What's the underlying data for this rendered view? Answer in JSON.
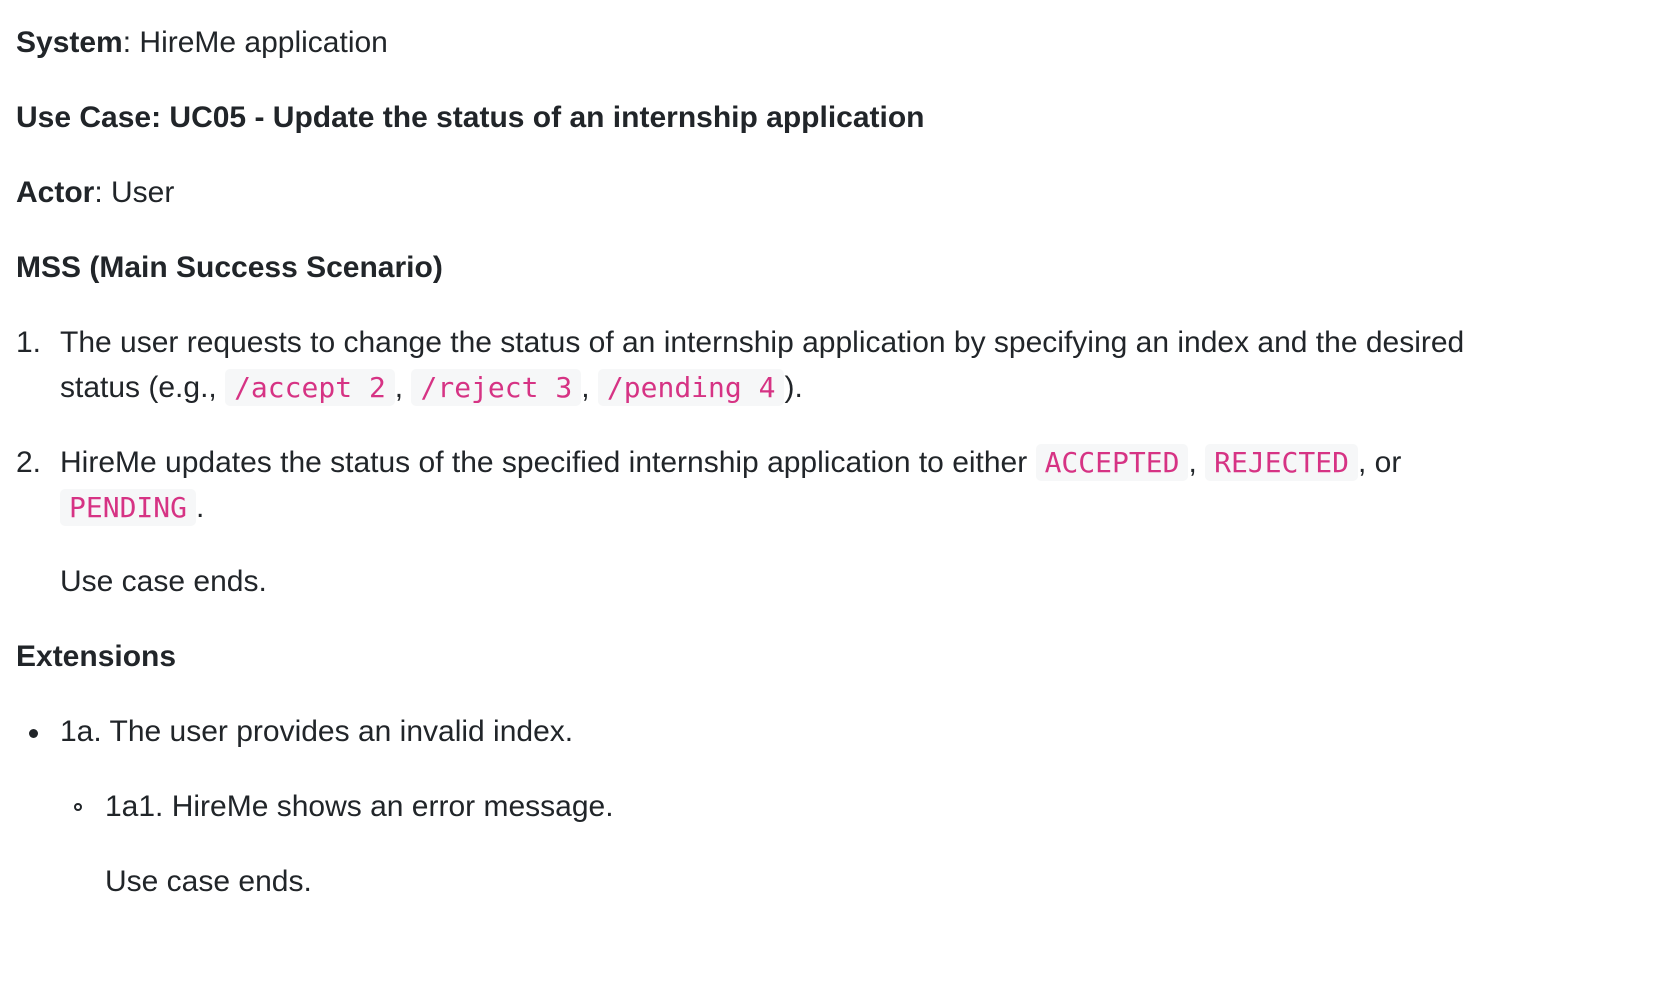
{
  "system": {
    "label": "System",
    "value": ": HireMe application"
  },
  "use_case": {
    "title": "Use Case: UC05 - Update the status of an internship application"
  },
  "actor": {
    "label": "Actor",
    "value": ": User"
  },
  "mss": {
    "heading": "MSS (Main Success Scenario)"
  },
  "steps": [
    {
      "number": "1.",
      "line1": "The user requests to change the status of an internship application by specifying an index and the desired",
      "line2_prefix": "status (e.g., ",
      "codes": [
        "/accept 2",
        "/reject 3",
        "/pending 4"
      ],
      "sep": ",",
      "line2_suffix": ")."
    },
    {
      "number": "2.",
      "line1_prefix": "HireMe updates the status of the specified internship application to either ",
      "codes": [
        "ACCEPTED",
        "REJECTED",
        "PENDING"
      ],
      "sep": ",",
      "or_text": ", or",
      "end": ".",
      "after": "Use case ends."
    }
  ],
  "extensions": {
    "heading": "Extensions",
    "item": "1a. The user provides an invalid index.",
    "sub_item": "1a1. HireMe shows an error message.",
    "sub_after": "Use case ends."
  }
}
